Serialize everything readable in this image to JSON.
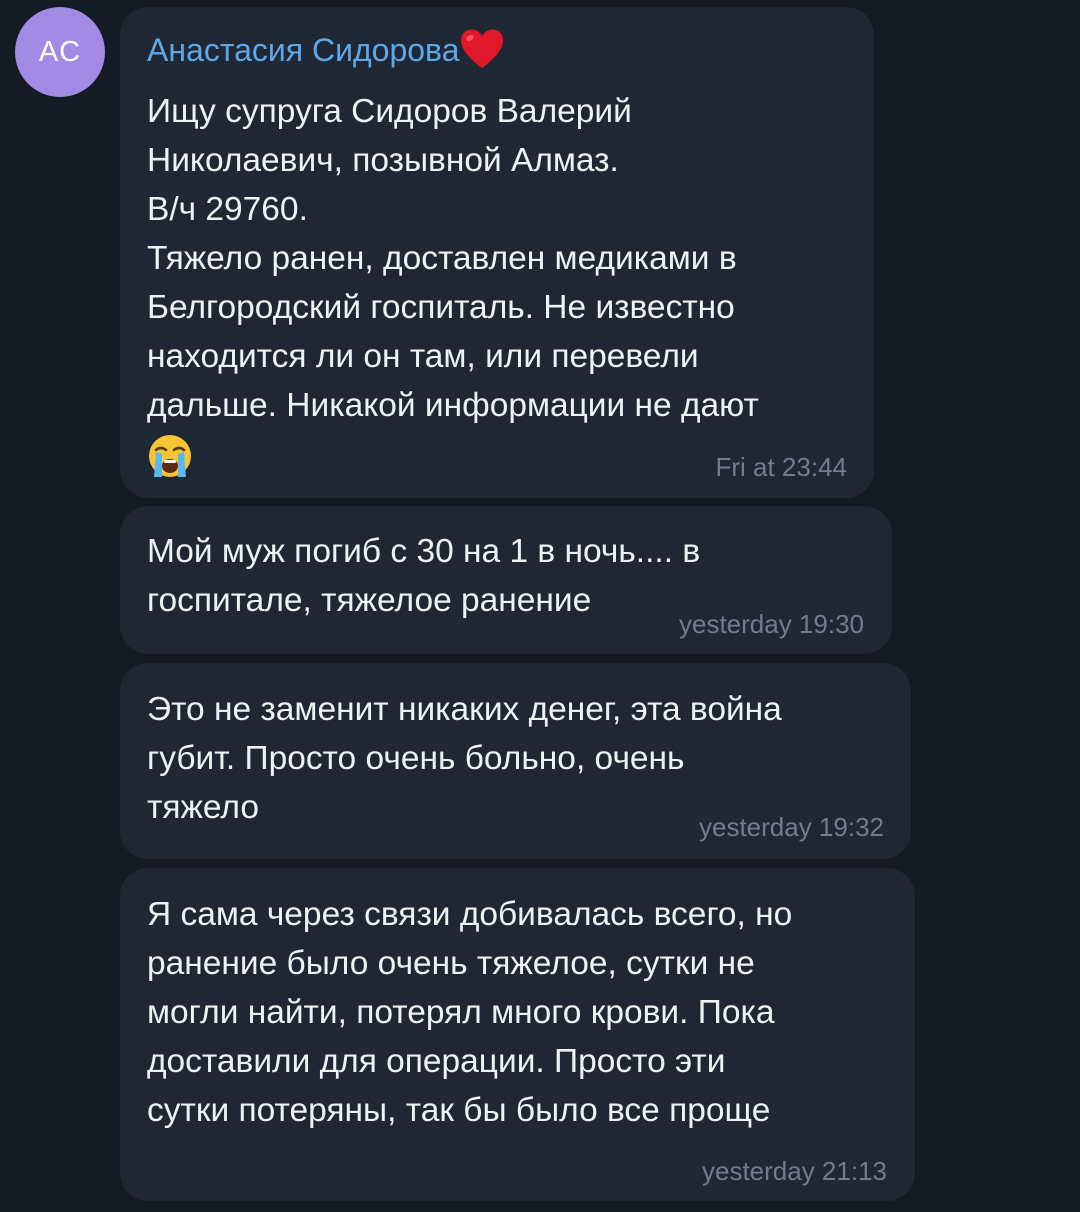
{
  "chat": {
    "avatar_initials": "AC",
    "sender_name": "Анастасия Сидорова",
    "sender_emoji": "heart-icon",
    "messages": [
      {
        "lines": [
          "Ищу супруга Сидоров Валерий",
          "Николаевич, позывной Алмаз.",
          "В/ч 29760.",
          "Тяжело ранен, доставлен медиками в",
          "Белгородский госпиталь. Не известно",
          "находится ли он там, или перевели",
          "дальше. Никакой информации не дают"
        ],
        "trailing_emoji": "crying-face-icon",
        "time": "Fri at 23:44"
      },
      {
        "lines": [
          "Мой муж погиб с 30 на 1 в ночь.... в",
          "госпитале, тяжелое ранение"
        ],
        "time": "yesterday 19:30"
      },
      {
        "lines": [
          "Это не заменит никаких денег, эта война",
          "губит. Просто очень больно, очень",
          "тяжело"
        ],
        "time": "yesterday 19:32"
      },
      {
        "lines": [
          "Я сама через связи добивалась всего, но",
          "ранение было очень тяжелое, сутки не",
          "могли найти, потерял много крови. Пока",
          "доставили для операции. Просто эти",
          "сутки потеряны, так бы было все проще"
        ],
        "time": "yesterday 21:13"
      }
    ]
  },
  "colors": {
    "background": "#151b25",
    "bubble": "#1f2735",
    "sender_name": "#5fa8e6",
    "text": "#eef1f5",
    "timestamp": "#6f7d8f",
    "avatar": "#a28be4"
  }
}
